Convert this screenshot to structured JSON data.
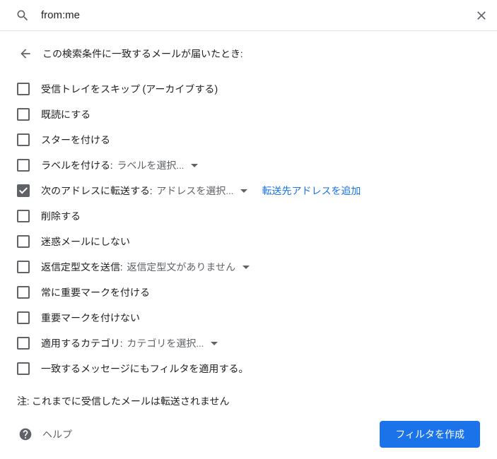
{
  "search": {
    "query": "from:me"
  },
  "header": {
    "title": "この検索条件に一致するメールが届いたとき:"
  },
  "options": [
    {
      "label": "受信トレイをスキップ (アーカイブする)",
      "checked": false
    },
    {
      "label": "既読にする",
      "checked": false
    },
    {
      "label": "スターを付ける",
      "checked": false
    },
    {
      "label": "ラベルを付ける:",
      "checked": false,
      "dropdown": "ラベルを選択..."
    },
    {
      "label": "次のアドレスに転送する:",
      "checked": true,
      "dropdown": "アドレスを選択...",
      "link": "転送先アドレスを追加"
    },
    {
      "label": "削除する",
      "checked": false
    },
    {
      "label": "迷惑メールにしない",
      "checked": false
    },
    {
      "label": "返信定型文を送信:",
      "checked": false,
      "dropdown": "返信定型文がありません"
    },
    {
      "label": "常に重要マークを付ける",
      "checked": false
    },
    {
      "label": "重要マークを付けない",
      "checked": false
    },
    {
      "label": "適用するカテゴリ:",
      "checked": false,
      "dropdown": "カテゴリを選択..."
    },
    {
      "label": "一致するメッセージにもフィルタを適用する。",
      "checked": false
    }
  ],
  "note": "注: これまでに受信したメールは転送されません",
  "footer": {
    "help": "ヘルプ",
    "create": "フィルタを作成"
  }
}
